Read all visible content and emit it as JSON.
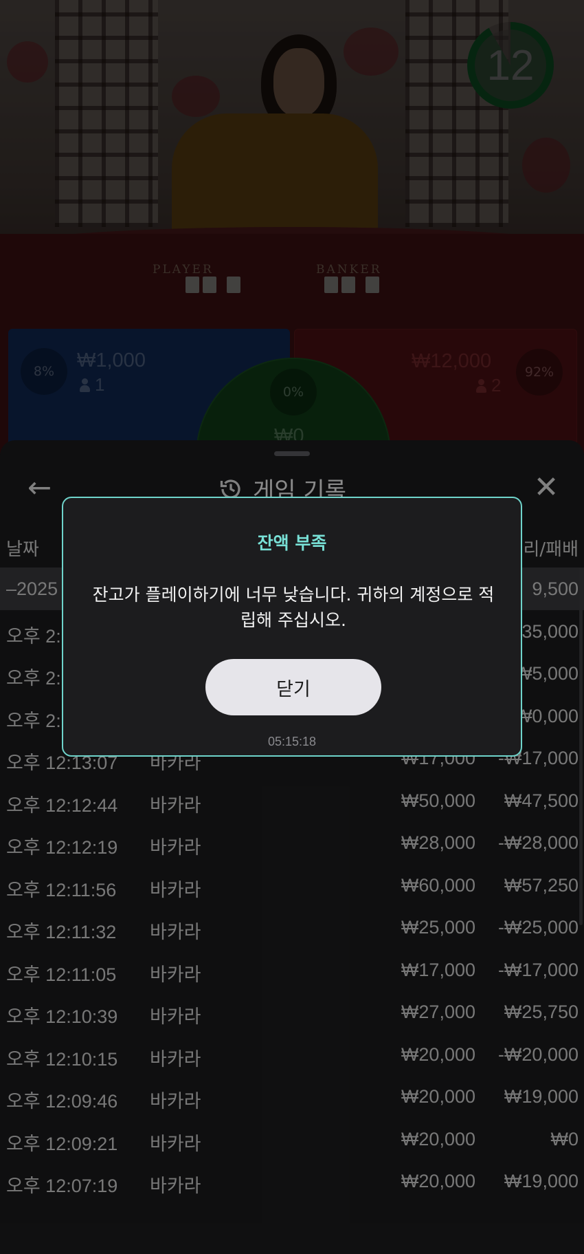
{
  "video": {
    "timer": "12",
    "felt_player_label": "PLAYER",
    "felt_banker_label": "BANKER",
    "player": {
      "percent": "8%",
      "amount": "₩1,000",
      "count": "1"
    },
    "tie": {
      "percent": "0%",
      "amount": "₩0"
    },
    "banker": {
      "percent": "92%",
      "amount": "₩12,000",
      "count": "2"
    },
    "colors": {
      "player": "#1e4a9a",
      "banker": "#8a1f24",
      "tie": "#1d6e2a",
      "timer_ring": "#17803a"
    }
  },
  "sheet": {
    "title": "게임 기록",
    "title_icon": "history-icon",
    "back_icon": "arrow-left-icon",
    "back_glyph": "←",
    "close_icon": "close-icon",
    "close_glyph": "✕",
    "columns": {
      "date": "날짜",
      "win_loss": "리/패배"
    },
    "rows": [
      {
        "date": "–2025",
        "game": "",
        "bet": "",
        "result": "9,500"
      },
      {
        "date": "오후 2:",
        "game": "",
        "bet": "",
        "result": "₩35,000"
      },
      {
        "date": "오후 2:",
        "game": "",
        "bet": "",
        "result": "₩5,000"
      },
      {
        "date": "오후 2:",
        "game": "",
        "bet": "",
        "result": "₩0,000"
      },
      {
        "date": "오후 12:13:07",
        "game": "바카라",
        "bet": "₩17,000",
        "result": "-₩17,000"
      },
      {
        "date": "오후 12:12:44",
        "game": "바카라",
        "bet": "₩50,000",
        "result": "₩47,500"
      },
      {
        "date": "오후 12:12:19",
        "game": "바카라",
        "bet": "₩28,000",
        "result": "-₩28,000"
      },
      {
        "date": "오후 12:11:56",
        "game": "바카라",
        "bet": "₩60,000",
        "result": "₩57,250"
      },
      {
        "date": "오후 12:11:32",
        "game": "바카라",
        "bet": "₩25,000",
        "result": "-₩25,000"
      },
      {
        "date": "오후 12:11:05",
        "game": "바카라",
        "bet": "₩17,000",
        "result": "-₩17,000"
      },
      {
        "date": "오후 12:10:39",
        "game": "바카라",
        "bet": "₩27,000",
        "result": "₩25,750"
      },
      {
        "date": "오후 12:10:15",
        "game": "바카라",
        "bet": "₩20,000",
        "result": "-₩20,000"
      },
      {
        "date": "오후 12:09:46",
        "game": "바카라",
        "bet": "₩20,000",
        "result": "₩19,000"
      },
      {
        "date": "오후 12:09:21",
        "game": "바카라",
        "bet": "₩20,000",
        "result": "₩0"
      },
      {
        "date": "오후 12:07:19",
        "game": "바카라",
        "bet": "₩20,000",
        "result": "₩19,000"
      },
      {
        "date": "",
        "game": "",
        "bet": "",
        "result": ""
      }
    ]
  },
  "modal": {
    "title": "잔액 부족",
    "message": "잔고가 플레이하기에 너무 낮습니다. 귀하의 계정으로 적립해 주십시오.",
    "close_button": "닫기",
    "time": "05:15:18",
    "accent_color": "#78e0d6"
  }
}
